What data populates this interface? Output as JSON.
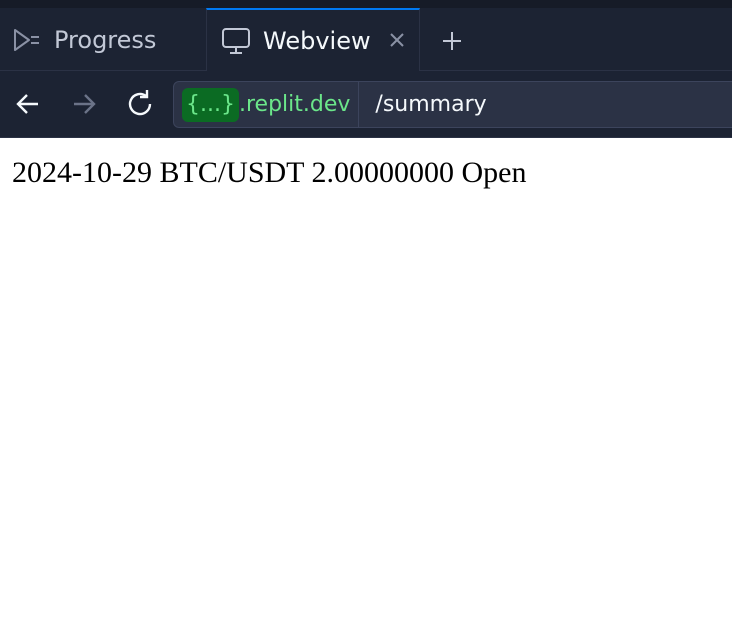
{
  "tabs": [
    {
      "label": "Progress",
      "icon": "progress-icon",
      "active": false
    },
    {
      "label": "Webview",
      "icon": "monitor-icon",
      "active": true
    }
  ],
  "tab_close_icon": "close-icon",
  "add_tab_icon": "plus-icon",
  "nav": {
    "back_icon": "arrow-left-icon",
    "forward_icon": "arrow-right-icon",
    "reload_icon": "reload-icon"
  },
  "url": {
    "host_badge": "{...}",
    "host_domain": ".replit.dev",
    "path": "/summary"
  },
  "page": {
    "content": "2024-10-29 BTC/USDT 2.00000000 Open"
  },
  "colors": {
    "chrome_bg": "#1c2333",
    "active_tab_accent": "#0079f2",
    "url_green": "#6be68a",
    "badge_green": "#0b6b23"
  }
}
